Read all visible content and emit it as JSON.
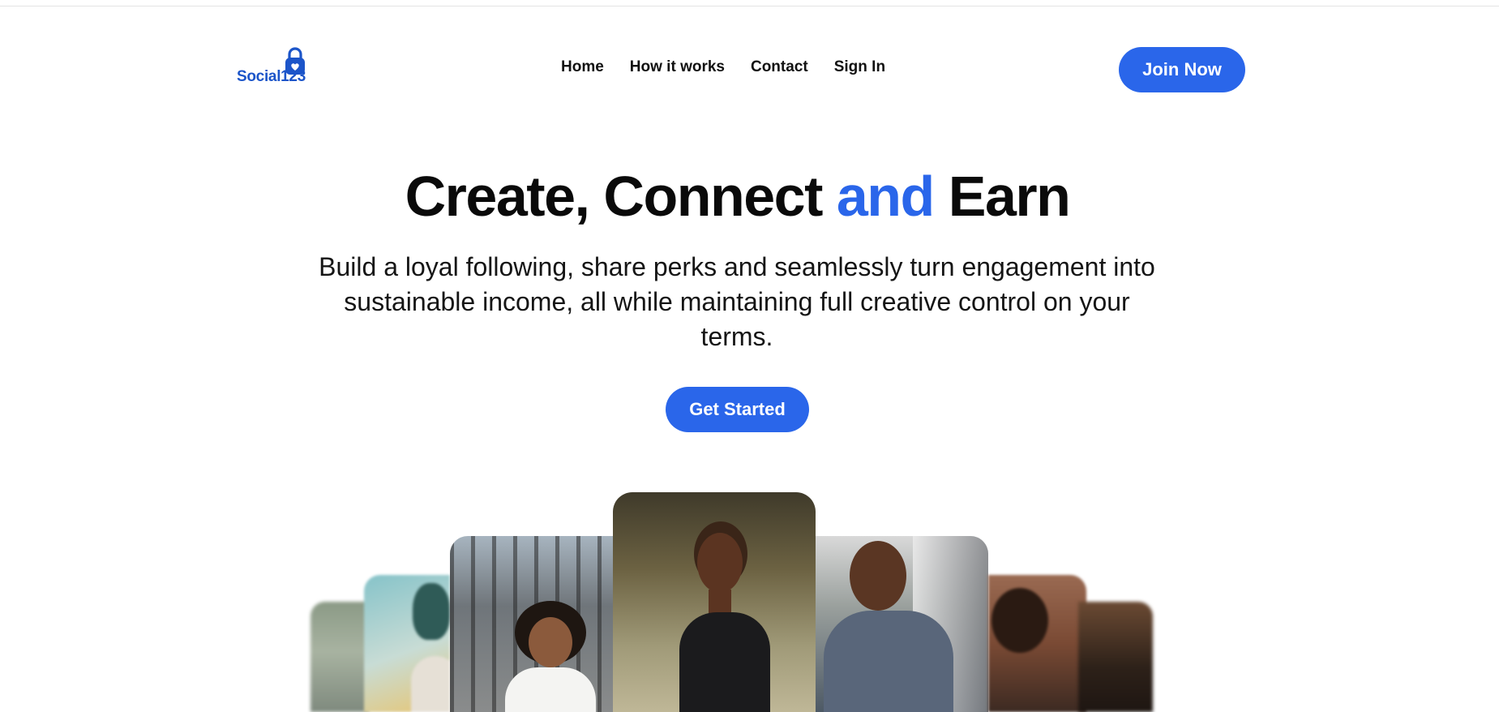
{
  "brand": {
    "name": "Social123",
    "accent": "#2a66ea"
  },
  "nav": {
    "items": [
      {
        "label": "Home"
      },
      {
        "label": "How it works"
      },
      {
        "label": "Contact"
      },
      {
        "label": "Sign In"
      }
    ],
    "join_label": "Join Now"
  },
  "hero": {
    "title_part1": "Create, Connect ",
    "title_accent": "and",
    "title_part2": " Earn",
    "subtitle": "Build a loyal following, share perks and seamlessly turn engagement into sustainable income, all while maintaining full creative control on your terms.",
    "cta_label": "Get Started"
  },
  "gallery": {
    "photos": [
      {
        "name": "photo-far-left"
      },
      {
        "name": "photo-left-2"
      },
      {
        "name": "photo-left-1"
      },
      {
        "name": "photo-center"
      },
      {
        "name": "photo-right-1"
      },
      {
        "name": "photo-right-2"
      },
      {
        "name": "photo-far-right"
      }
    ]
  }
}
